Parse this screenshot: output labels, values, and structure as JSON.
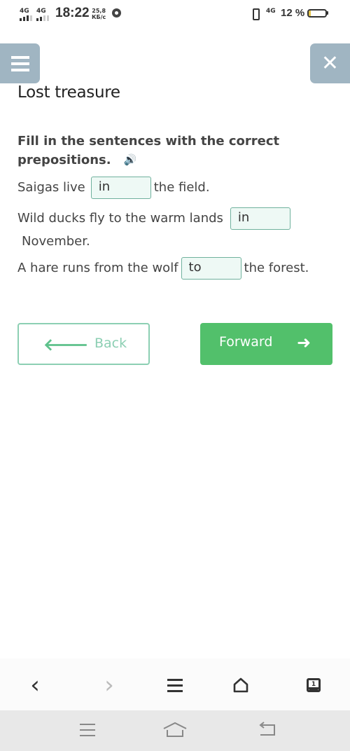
{
  "status_bar": {
    "network1": "4G",
    "network2": "4G",
    "time": "18:22",
    "speed_value": "25,8",
    "speed_unit": "КБ/с",
    "network3": "4G",
    "battery_text": "12 %",
    "battery_level": 0.12
  },
  "header": {
    "menu_icon": "hamburger-icon",
    "close_icon": "close-icon",
    "close_glyph": "✕",
    "title": "Lost treasure"
  },
  "exercise": {
    "instructions": "Fill in the sentences with the correct prepositions.",
    "speaker_icon": "🔊",
    "sentences": [
      {
        "before": "Saigas live",
        "answer": "in",
        "after": "the field."
      },
      {
        "before": "Wild ducks fly to the warm lands",
        "answer": "in",
        "after": "November."
      },
      {
        "before": "A hare runs from the wolf",
        "answer": "to",
        "after": "the forest."
      }
    ]
  },
  "navigation": {
    "back_label": "Back",
    "back_arrow": "🡐",
    "forward_label": "Forward",
    "forward_arrow": "➜"
  },
  "browser_bar": {
    "back_glyph": "‹",
    "forward_glyph": "›",
    "tab_count": "1"
  },
  "colors": {
    "accent_green": "#52c06b",
    "header_button": "#a0b5c2",
    "blank_border": "#6fb19d",
    "blank_fill": "#eef9f5"
  }
}
